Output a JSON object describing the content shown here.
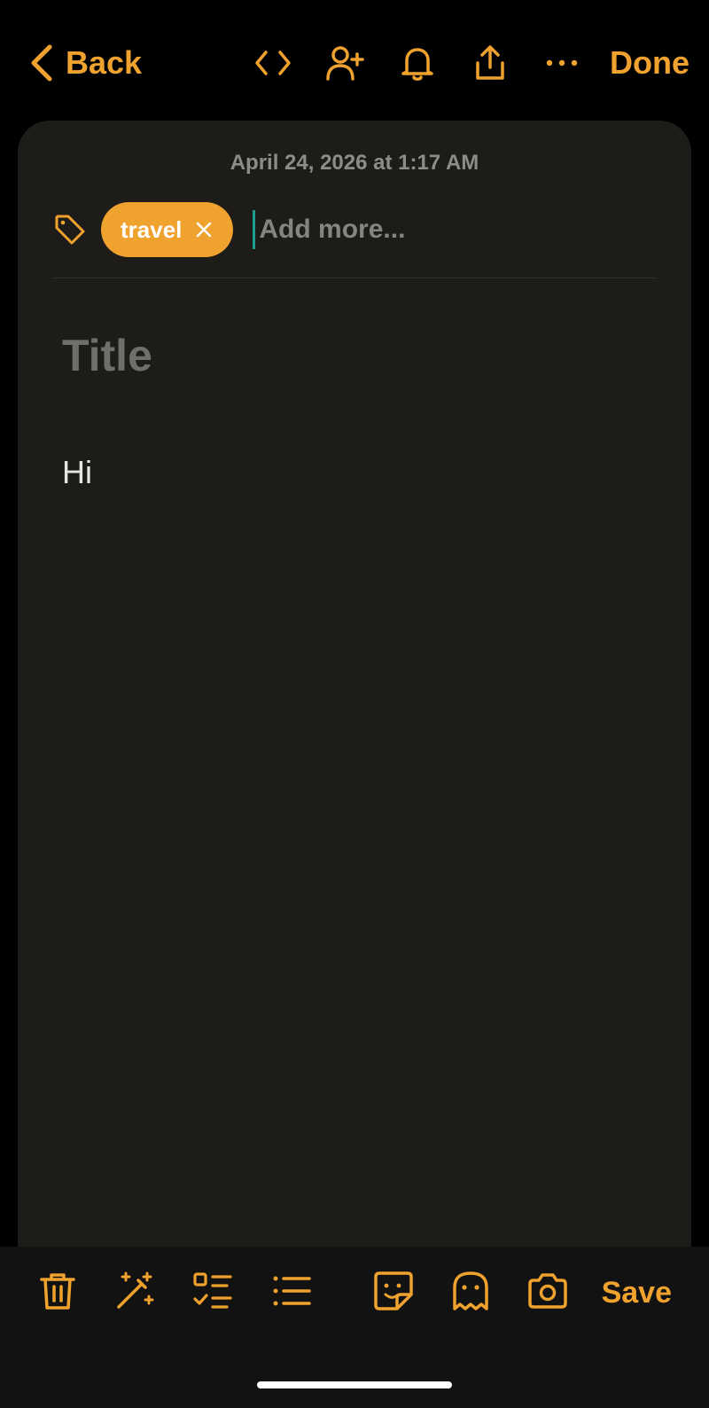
{
  "header": {
    "back_label": "Back",
    "done_label": "Done",
    "icons": [
      "code-icon",
      "add-person-icon",
      "bell-icon",
      "share-icon",
      "more-icon"
    ]
  },
  "note": {
    "date": "April 24, 2026 at 1:17 AM",
    "tags": [
      {
        "label": "travel"
      }
    ],
    "tag_input_placeholder": "Add more...",
    "title_placeholder": "Title",
    "body": "Hi"
  },
  "toolbar": {
    "save_label": "Save",
    "icons": [
      "trash-icon",
      "magic-wand-icon",
      "checklist-icon",
      "bullet-list-icon",
      "sticker-icon",
      "ghost-icon",
      "camera-icon"
    ]
  },
  "colors": {
    "accent": "#F0A22E",
    "card_background": "#1D1C19",
    "page_background": "#000000",
    "toolbar_background": "#121212",
    "cursor": "#1F9E8C"
  }
}
